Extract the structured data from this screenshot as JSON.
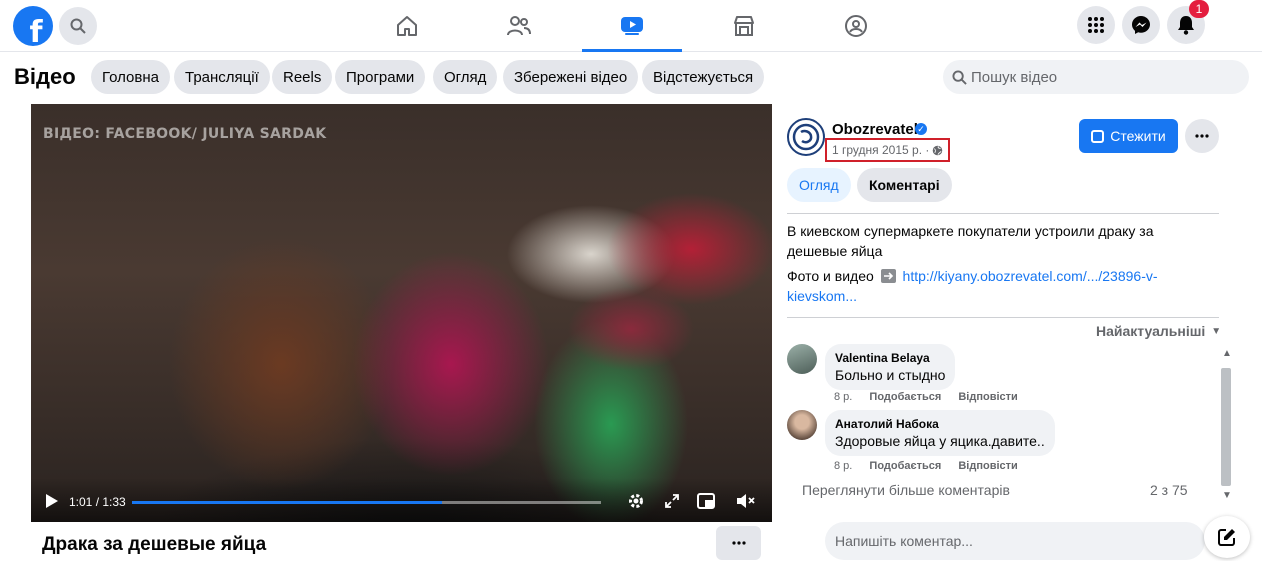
{
  "header": {
    "logo_letter": "f",
    "notification_count": "1",
    "nav_tabs": [
      {
        "name": "home-icon",
        "active": false
      },
      {
        "name": "friends-icon",
        "active": false
      },
      {
        "name": "watch-icon",
        "active": true
      },
      {
        "name": "marketplace-icon",
        "active": false
      },
      {
        "name": "groups-icon",
        "active": false
      }
    ],
    "right_icons": [
      "menu-grid-icon",
      "messenger-icon",
      "bell-icon"
    ]
  },
  "subnav": {
    "title": "Відео",
    "chips": [
      "Головна",
      "Трансляції",
      "Reels",
      "Програми",
      "Огляд",
      "Збережені відео",
      "Відстежується"
    ],
    "search_placeholder": "Пошук відео"
  },
  "player": {
    "watermark": "ВІДЕО: FACEBOOK/ JULIYA SARDAK",
    "time": "1:01 / 1:33",
    "progress": 0.66,
    "buffered": 0.66,
    "accent_color": "#1877f2"
  },
  "video_title": "Драка за дешевые яйца",
  "post": {
    "page_name": "Obozrevatel",
    "date": "1 грудня 2015 р. ·",
    "follow_label": "Стежити",
    "tabs": [
      "Огляд",
      "Коментарі"
    ],
    "description": "В киевском супермаркете покупатели устроили драку за дешевые яйца",
    "link_prefix": "Фото и видео",
    "link_text": "http://kiyany.obozrevatel.com/.../23896-v-kievskom...",
    "sort_label": "Найактуальніші",
    "comments": [
      {
        "author": "Valentina Belaya",
        "text": "Больно и стыдно",
        "time": "8 р.",
        "like": "Подобається",
        "reply": "Відповісти"
      },
      {
        "author": "Анатолий Набока",
        "text": "Здоровые яйца у яцика.давите..",
        "time": "8 р.",
        "like": "Подобається",
        "reply": "Відповісти"
      }
    ],
    "more_comments": "Переглянути більше коментарів",
    "comment_count": "2 з 75",
    "comment_placeholder": "Напишіть коментар..."
  }
}
